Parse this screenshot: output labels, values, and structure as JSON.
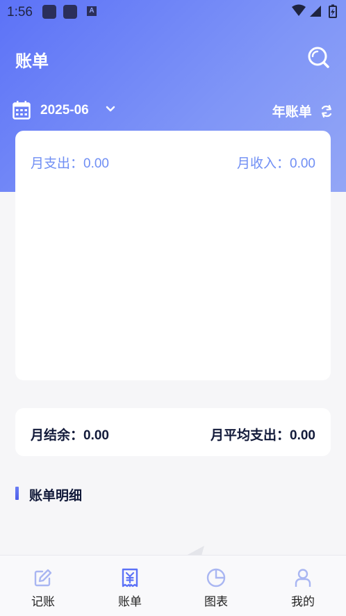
{
  "status_bar": {
    "time": "1:56",
    "indicator": "A"
  },
  "header": {
    "title": "账单",
    "month": "2025-06",
    "year_bill_label": "年账单"
  },
  "summary": {
    "monthly_expense": "月支出：0.00",
    "monthly_income": "月收入：0.00"
  },
  "balance": {
    "monthly_balance": "月结余：0.00",
    "monthly_avg_expense": "月平均支出：0.00"
  },
  "section": {
    "title": "账单明细"
  },
  "tabs": [
    {
      "label": "记账",
      "icon": "edit-icon",
      "active": false
    },
    {
      "label": "账单",
      "icon": "bill-icon",
      "active": true
    },
    {
      "label": "图表",
      "icon": "pie-chart-icon",
      "active": false
    },
    {
      "label": "我的",
      "icon": "user-icon",
      "active": false
    }
  ],
  "colors": {
    "accent": "#5c72f7",
    "inactive_icon": "#a9b6f2",
    "text_dark": "#121a3a",
    "muted_blue": "#6f8ef4"
  }
}
